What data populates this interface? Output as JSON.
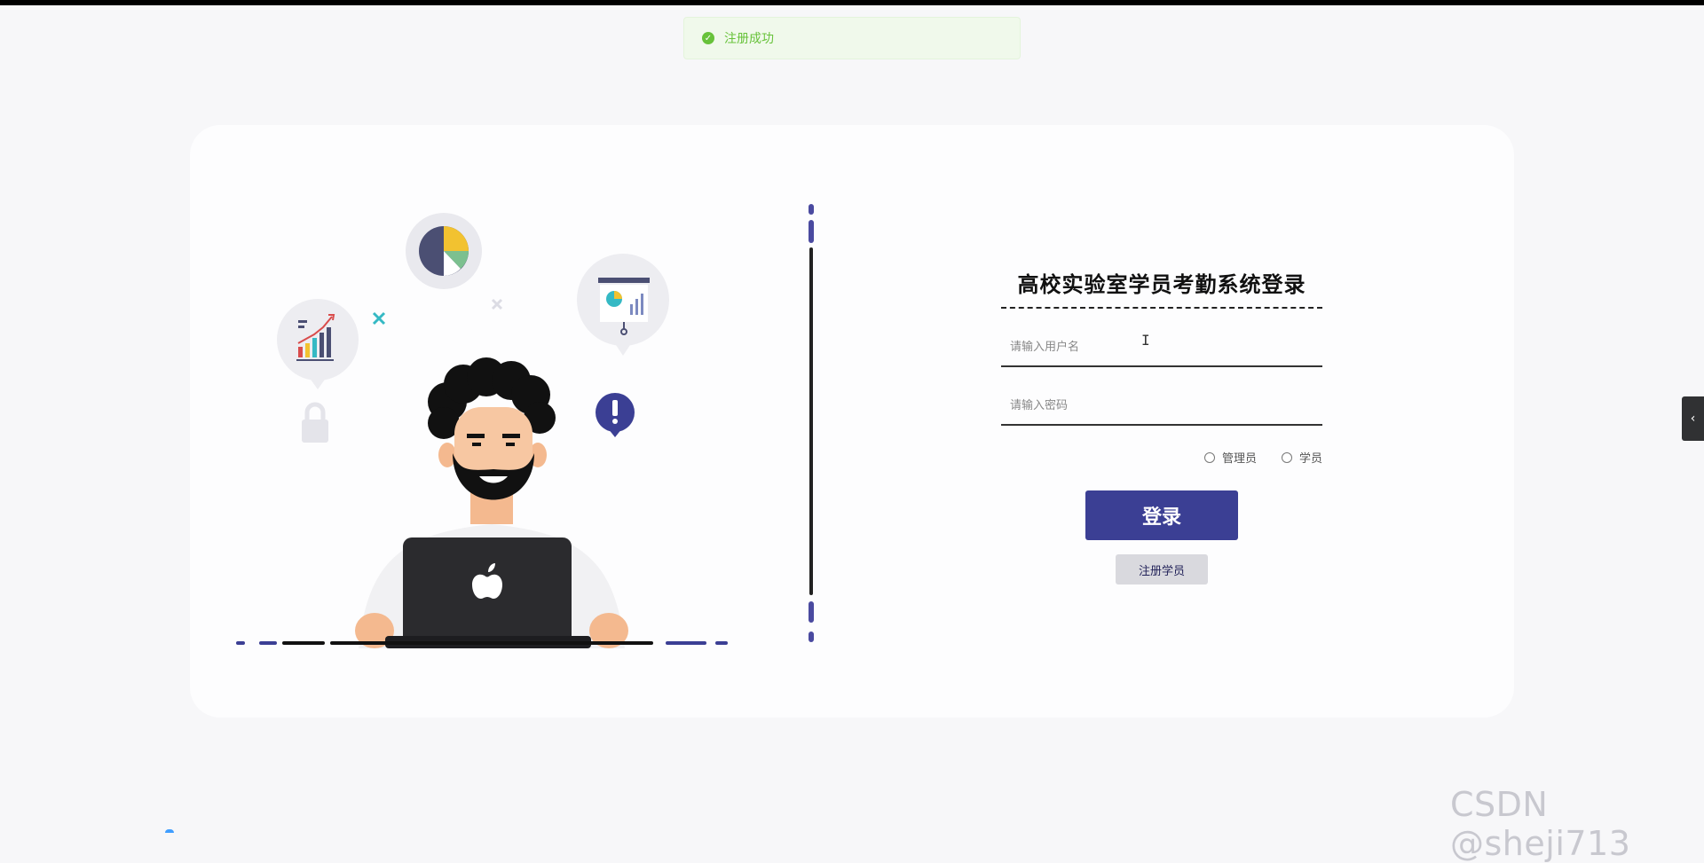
{
  "toast": {
    "message": "注册成功",
    "icon": "check-circle-icon",
    "color": "#67c23a"
  },
  "login": {
    "title": "高校实验室学员考勤系统登录",
    "username_placeholder": "请输入用户名",
    "password_placeholder": "请输入密码",
    "roles": [
      {
        "label": "管理员"
      },
      {
        "label": "学员"
      }
    ],
    "login_label": "登录",
    "register_label": "注册学员"
  },
  "colors": {
    "primary": "#3b3f94",
    "divider_accent": "#4a4aa0"
  },
  "side_toggle": {
    "icon": "chevron-left-icon",
    "glyph": "‹"
  },
  "watermark": "CSDN @sheji713",
  "illustration": {
    "icon": "man-with-laptop-illustration"
  }
}
